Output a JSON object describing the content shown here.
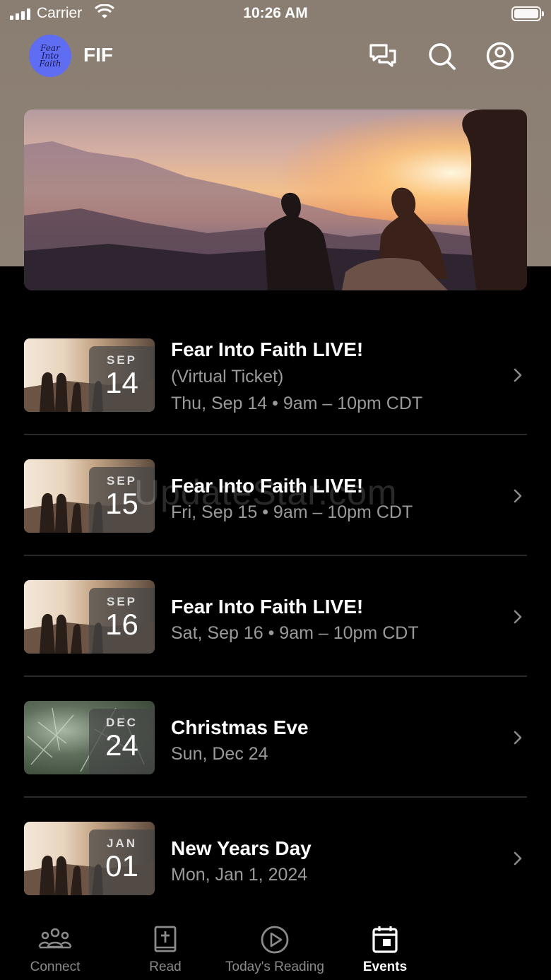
{
  "status_bar": {
    "carrier": "Carrier",
    "time": "10:26 AM"
  },
  "header": {
    "avatar_text": "Fear Into Faith",
    "title": "FIF",
    "icons": [
      "chat-icon",
      "search-icon",
      "profile-icon"
    ]
  },
  "events": [
    {
      "month": "SEP",
      "day": "14",
      "title": "Fear Into Faith LIVE!",
      "subtitle": "(Virtual Ticket)",
      "when": "Thu, Sep 14 • 9am – 10pm CDT",
      "thumb": "sunset"
    },
    {
      "month": "SEP",
      "day": "15",
      "title": "Fear Into Faith LIVE!",
      "when": "Fri, Sep 15 • 9am – 10pm CDT",
      "thumb": "sunset"
    },
    {
      "month": "SEP",
      "day": "16",
      "title": "Fear Into Faith LIVE!",
      "when": "Sat, Sep 16 • 9am – 10pm CDT",
      "thumb": "sunset"
    },
    {
      "month": "DEC",
      "day": "24",
      "title": "Christmas Eve",
      "when": "Sun, Dec 24",
      "thumb": "pine"
    },
    {
      "month": "JAN",
      "day": "01",
      "title": "New Years Day",
      "when": "Mon, Jan 1, 2024",
      "thumb": "sunset"
    }
  ],
  "watermark": "UpdateStar.com",
  "tabs": [
    {
      "label": "Connect",
      "icon": "people-icon",
      "active": false
    },
    {
      "label": "Read",
      "icon": "bible-icon",
      "active": false
    },
    {
      "label": "Today's Reading",
      "icon": "play-icon",
      "active": false
    },
    {
      "label": "Events",
      "icon": "calendar-icon",
      "active": true
    }
  ],
  "colors": {
    "header_bg": "#8d8074",
    "avatar_bg": "#5f6df3",
    "background": "#000000",
    "muted_text": "#9a9a9a"
  }
}
